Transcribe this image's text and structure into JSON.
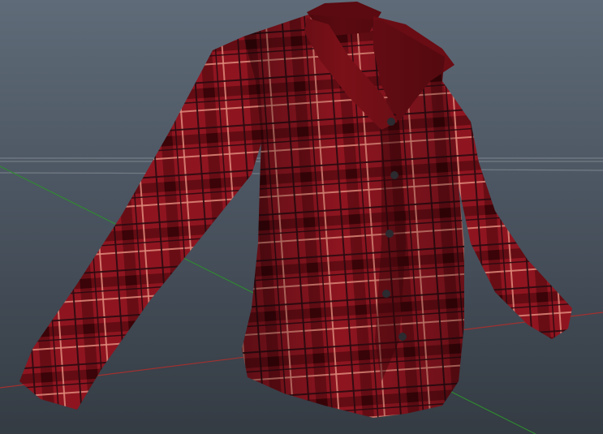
{
  "scene": {
    "background_top": "#5f6b78",
    "background_bottom": "#343b43",
    "grid_color": "#7d858e",
    "x_axis_color": "#a3302f",
    "z_axis_color": "#2f8a2f"
  },
  "model": {
    "object": "plaid jacket",
    "base_color": "#8e1520",
    "dark_color": "#4a0508",
    "stripe_light_color": "#e08a7a",
    "stripe_dark_color": "#2a0a10",
    "button_color": "#2b2b30",
    "button_count": 5
  }
}
